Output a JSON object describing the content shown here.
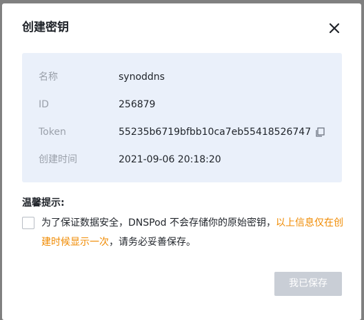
{
  "dialog": {
    "title": "创建密钥",
    "close_icon": "close-icon"
  },
  "info": {
    "name_label": "名称",
    "name_value": "synoddns",
    "id_label": "ID",
    "id_value": "256879",
    "token_label": "Token",
    "token_value": "55235b6719bfbb10ca7eb55418526747",
    "copy_icon": "copy-icon",
    "created_label": "创建时间",
    "created_value": "2021-09-06 20:18:20"
  },
  "tips": {
    "title": "温馨提示:",
    "text_prefix": "为了保证数据安全，DNSPod 不会存储你的原始密钥，",
    "text_highlight": "以上信息仅在创建时候显示一次",
    "text_suffix": "，请务必妥善保存。",
    "checked": false
  },
  "footer": {
    "ok_label": "我已保存",
    "ok_enabled": false
  },
  "colors": {
    "highlight": "#f08a00",
    "panel_bg": "#eaf0fa",
    "button_disabled": "#c9ced6"
  }
}
